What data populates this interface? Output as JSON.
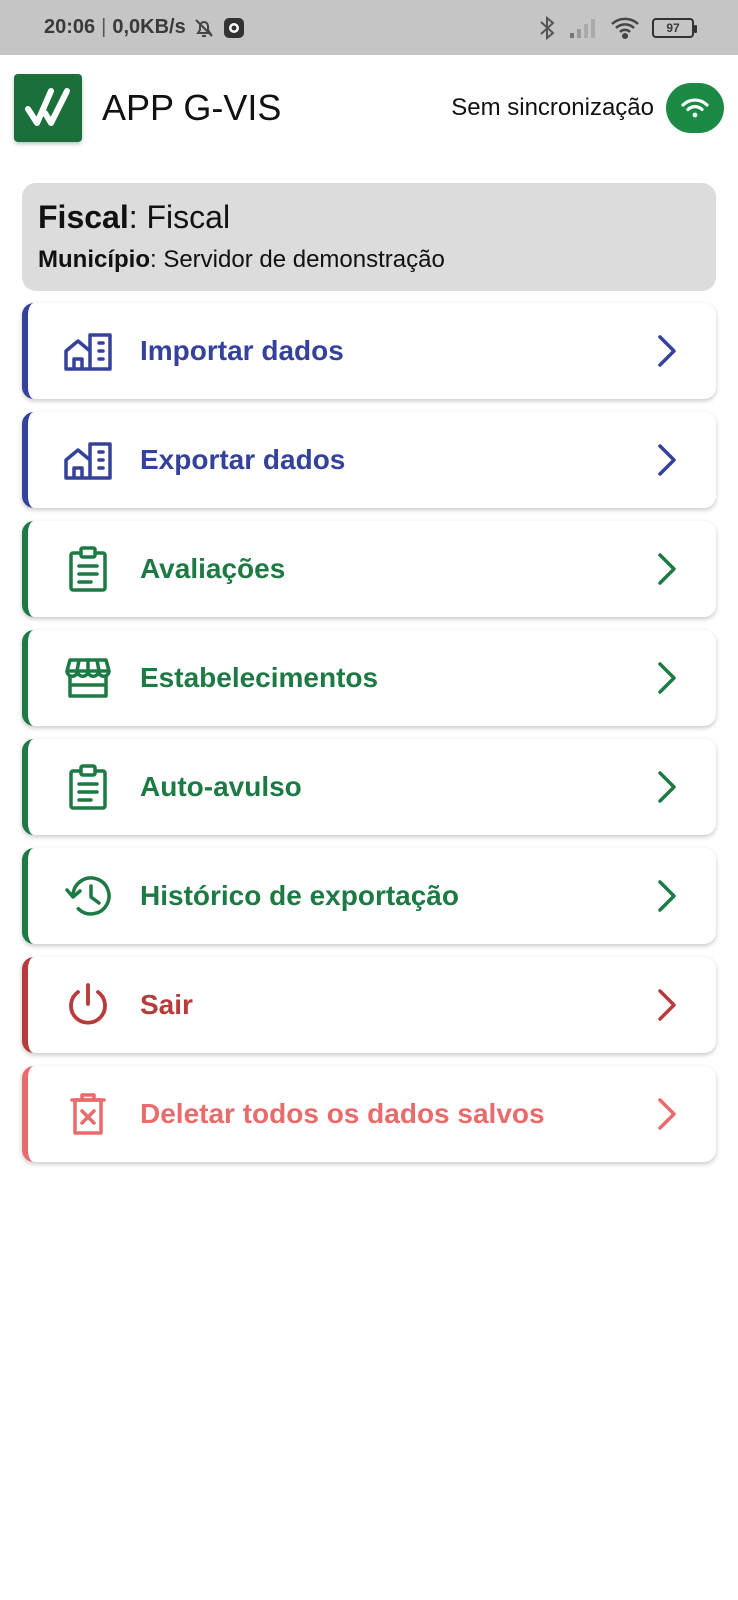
{
  "status_bar": {
    "time": "20:06",
    "speed": "0,0KB/s",
    "battery": "97",
    "icons": [
      "mute-bell-icon",
      "app-notification-icon",
      "bluetooth-icon",
      "signal-icon",
      "wifi-icon",
      "battery-icon"
    ]
  },
  "header": {
    "title": "APP G-VIS",
    "sync_label": "Sem sincronização",
    "logo_icon": "double-check-icon",
    "sync_icon": "wifi-icon",
    "brand_color": "#1b6f3b"
  },
  "info": {
    "fiscal_key": "Fiscal",
    "fiscal_value": ": Fiscal",
    "municipio_key": "Município",
    "municipio_value": ": Servidor de demonstração"
  },
  "menu": {
    "items": [
      {
        "label": "Importar dados",
        "icon": "buildings-icon",
        "color": "#35429c"
      },
      {
        "label": "Exportar dados",
        "icon": "buildings-icon",
        "color": "#35429c"
      },
      {
        "label": "Avaliações",
        "icon": "clipboard-icon",
        "color": "#1d7a44"
      },
      {
        "label": "Estabelecimentos",
        "icon": "store-icon",
        "color": "#1d7a44"
      },
      {
        "label": "Auto-avulso",
        "icon": "clipboard-icon",
        "color": "#1d7a44"
      },
      {
        "label": "Histórico de exportação",
        "icon": "history-icon",
        "color": "#1d7a44"
      },
      {
        "label": "Sair",
        "icon": "power-icon",
        "color": "#b83a3a"
      },
      {
        "label": "Deletar todos os dados salvos",
        "icon": "delete-icon",
        "color": "#e96b6b"
      }
    ]
  }
}
